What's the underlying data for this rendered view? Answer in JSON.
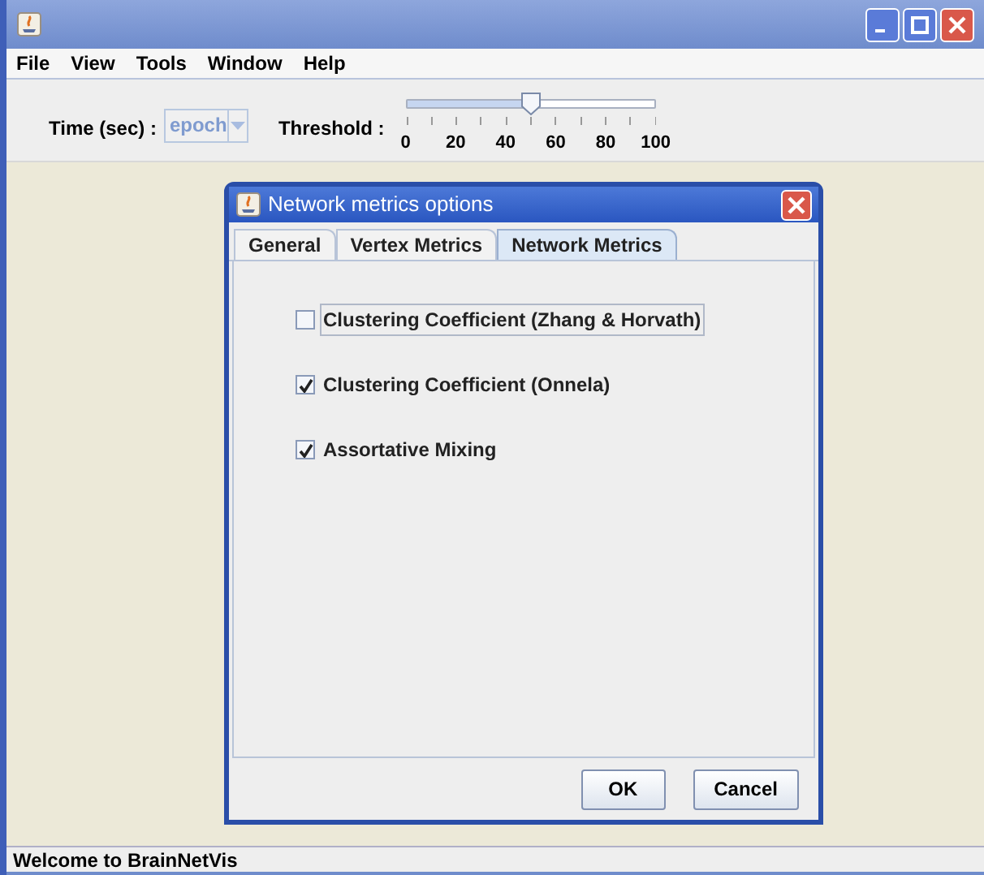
{
  "menu": [
    "File",
    "View",
    "Tools",
    "Window",
    "Help"
  ],
  "toolbar": {
    "time_label": "Time (sec) :",
    "time_combo": {
      "value": "epoch",
      "disabled": true
    },
    "threshold_label": "Threshold :",
    "threshold_slider": {
      "level": 0.5,
      "tick_labels": [
        "0",
        "20",
        "40",
        "60",
        "80",
        "100"
      ]
    }
  },
  "dialog": {
    "title": "Network metrics options",
    "tabs": [
      {
        "label": "General",
        "selected": false
      },
      {
        "label": "Vertex Metrics",
        "selected": false
      },
      {
        "label": "Network Metrics",
        "selected": true
      }
    ],
    "options": [
      {
        "label": "Clustering Coefficient (Zhang & Horvath)",
        "checked": false,
        "focused": true
      },
      {
        "label": "Clustering Coefficient (Onnela)",
        "checked": true,
        "focused": false
      },
      {
        "label": "Assortative Mixing",
        "checked": true,
        "focused": false
      }
    ],
    "buttons": [
      "OK",
      "Cancel"
    ]
  },
  "status_bar": "Welcome to BrainNetVis"
}
